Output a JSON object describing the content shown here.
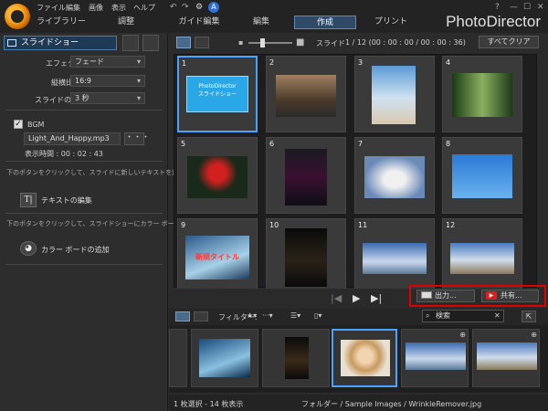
{
  "menu": [
    "ファイル",
    "編集",
    "画像",
    "表示",
    "ヘルプ"
  ],
  "window_controls": {
    "help": "?",
    "minimize": "—",
    "maximize": "☐",
    "close": "✕"
  },
  "nav_tabs": [
    "ライブラリー",
    "調整",
    "ガイド編集",
    "編集",
    "作成",
    "プリント"
  ],
  "active_tab": "作成",
  "brand": "PhotoDirector",
  "left_panel": {
    "header": "スライドショー",
    "effect_label": "エフェクト",
    "effect_value": "フェード",
    "aspect_label": "縦横比",
    "aspect_value": "16:9",
    "length_label": "スライドの長さ",
    "length_value": "3 秒",
    "bgm_label": "BGM",
    "bgm_checked": true,
    "bgm_file": "Light_And_Happy.mp3",
    "more_button": "・・・",
    "duration": "表示時間 : 00 : 02 : 43",
    "text_hint": "下のボタンをクリックして、スライドに新しいテキストを追加します。",
    "text_button": "テキストの編集",
    "color_hint": "下のボタンをクリックして、スライドショーにカラー ボードを追加します。",
    "color_button": "カラー ボードの追加"
  },
  "toolbar": {
    "slide_label": "スライド",
    "slide_counter": "1  /  12 (00 : 00 : 00 / 00 : 00 : 36)",
    "clear_all": "すべてクリア"
  },
  "slides": [
    {
      "n": "1",
      "caption": "PhotoDirector\nスライドショー"
    },
    {
      "n": "2"
    },
    {
      "n": "3"
    },
    {
      "n": "4"
    },
    {
      "n": "5"
    },
    {
      "n": "6"
    },
    {
      "n": "7"
    },
    {
      "n": "8"
    },
    {
      "n": "9",
      "caption": "新規タイトル"
    },
    {
      "n": "10"
    },
    {
      "n": "11"
    },
    {
      "n": "12"
    }
  ],
  "playback": {
    "output": "出力...",
    "share": "共有..."
  },
  "filter": {
    "label": "フィルター:",
    "search_placeholder": "検索"
  },
  "status": {
    "selection": "1 枚選択 - 14 枚表示",
    "folder": "フォルダー / Sample Images / WrinkleRemover.jpg"
  },
  "colors": {
    "accent": "#4aa3ff",
    "highlight": "#e00000",
    "brand_orange": "#e07800"
  }
}
